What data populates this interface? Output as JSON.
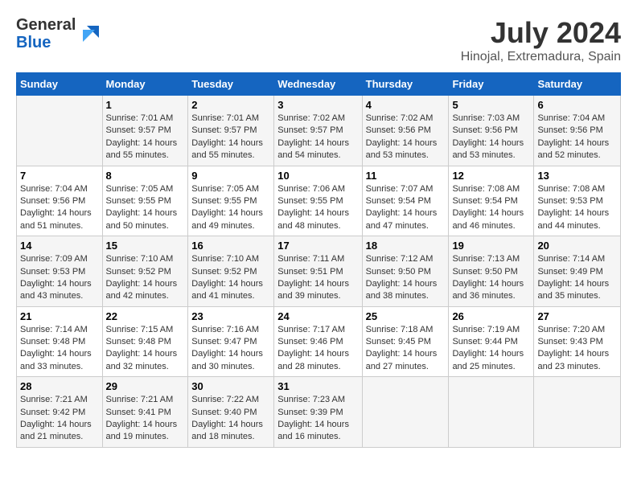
{
  "logo": {
    "general": "General",
    "blue": "Blue"
  },
  "title": {
    "month_year": "July 2024",
    "location": "Hinojal, Extremadura, Spain"
  },
  "days_of_week": [
    "Sunday",
    "Monday",
    "Tuesday",
    "Wednesday",
    "Thursday",
    "Friday",
    "Saturday"
  ],
  "weeks": [
    [
      {
        "day": "",
        "info": ""
      },
      {
        "day": "1",
        "info": "Sunrise: 7:01 AM\nSunset: 9:57 PM\nDaylight: 14 hours\nand 55 minutes."
      },
      {
        "day": "2",
        "info": "Sunrise: 7:01 AM\nSunset: 9:57 PM\nDaylight: 14 hours\nand 55 minutes."
      },
      {
        "day": "3",
        "info": "Sunrise: 7:02 AM\nSunset: 9:57 PM\nDaylight: 14 hours\nand 54 minutes."
      },
      {
        "day": "4",
        "info": "Sunrise: 7:02 AM\nSunset: 9:56 PM\nDaylight: 14 hours\nand 53 minutes."
      },
      {
        "day": "5",
        "info": "Sunrise: 7:03 AM\nSunset: 9:56 PM\nDaylight: 14 hours\nand 53 minutes."
      },
      {
        "day": "6",
        "info": "Sunrise: 7:04 AM\nSunset: 9:56 PM\nDaylight: 14 hours\nand 52 minutes."
      }
    ],
    [
      {
        "day": "7",
        "info": "Sunrise: 7:04 AM\nSunset: 9:56 PM\nDaylight: 14 hours\nand 51 minutes."
      },
      {
        "day": "8",
        "info": "Sunrise: 7:05 AM\nSunset: 9:55 PM\nDaylight: 14 hours\nand 50 minutes."
      },
      {
        "day": "9",
        "info": "Sunrise: 7:05 AM\nSunset: 9:55 PM\nDaylight: 14 hours\nand 49 minutes."
      },
      {
        "day": "10",
        "info": "Sunrise: 7:06 AM\nSunset: 9:55 PM\nDaylight: 14 hours\nand 48 minutes."
      },
      {
        "day": "11",
        "info": "Sunrise: 7:07 AM\nSunset: 9:54 PM\nDaylight: 14 hours\nand 47 minutes."
      },
      {
        "day": "12",
        "info": "Sunrise: 7:08 AM\nSunset: 9:54 PM\nDaylight: 14 hours\nand 46 minutes."
      },
      {
        "day": "13",
        "info": "Sunrise: 7:08 AM\nSunset: 9:53 PM\nDaylight: 14 hours\nand 44 minutes."
      }
    ],
    [
      {
        "day": "14",
        "info": "Sunrise: 7:09 AM\nSunset: 9:53 PM\nDaylight: 14 hours\nand 43 minutes."
      },
      {
        "day": "15",
        "info": "Sunrise: 7:10 AM\nSunset: 9:52 PM\nDaylight: 14 hours\nand 42 minutes."
      },
      {
        "day": "16",
        "info": "Sunrise: 7:10 AM\nSunset: 9:52 PM\nDaylight: 14 hours\nand 41 minutes."
      },
      {
        "day": "17",
        "info": "Sunrise: 7:11 AM\nSunset: 9:51 PM\nDaylight: 14 hours\nand 39 minutes."
      },
      {
        "day": "18",
        "info": "Sunrise: 7:12 AM\nSunset: 9:50 PM\nDaylight: 14 hours\nand 38 minutes."
      },
      {
        "day": "19",
        "info": "Sunrise: 7:13 AM\nSunset: 9:50 PM\nDaylight: 14 hours\nand 36 minutes."
      },
      {
        "day": "20",
        "info": "Sunrise: 7:14 AM\nSunset: 9:49 PM\nDaylight: 14 hours\nand 35 minutes."
      }
    ],
    [
      {
        "day": "21",
        "info": "Sunrise: 7:14 AM\nSunset: 9:48 PM\nDaylight: 14 hours\nand 33 minutes."
      },
      {
        "day": "22",
        "info": "Sunrise: 7:15 AM\nSunset: 9:48 PM\nDaylight: 14 hours\nand 32 minutes."
      },
      {
        "day": "23",
        "info": "Sunrise: 7:16 AM\nSunset: 9:47 PM\nDaylight: 14 hours\nand 30 minutes."
      },
      {
        "day": "24",
        "info": "Sunrise: 7:17 AM\nSunset: 9:46 PM\nDaylight: 14 hours\nand 28 minutes."
      },
      {
        "day": "25",
        "info": "Sunrise: 7:18 AM\nSunset: 9:45 PM\nDaylight: 14 hours\nand 27 minutes."
      },
      {
        "day": "26",
        "info": "Sunrise: 7:19 AM\nSunset: 9:44 PM\nDaylight: 14 hours\nand 25 minutes."
      },
      {
        "day": "27",
        "info": "Sunrise: 7:20 AM\nSunset: 9:43 PM\nDaylight: 14 hours\nand 23 minutes."
      }
    ],
    [
      {
        "day": "28",
        "info": "Sunrise: 7:21 AM\nSunset: 9:42 PM\nDaylight: 14 hours\nand 21 minutes."
      },
      {
        "day": "29",
        "info": "Sunrise: 7:21 AM\nSunset: 9:41 PM\nDaylight: 14 hours\nand 19 minutes."
      },
      {
        "day": "30",
        "info": "Sunrise: 7:22 AM\nSunset: 9:40 PM\nDaylight: 14 hours\nand 18 minutes."
      },
      {
        "day": "31",
        "info": "Sunrise: 7:23 AM\nSunset: 9:39 PM\nDaylight: 14 hours\nand 16 minutes."
      },
      {
        "day": "",
        "info": ""
      },
      {
        "day": "",
        "info": ""
      },
      {
        "day": "",
        "info": ""
      }
    ]
  ]
}
